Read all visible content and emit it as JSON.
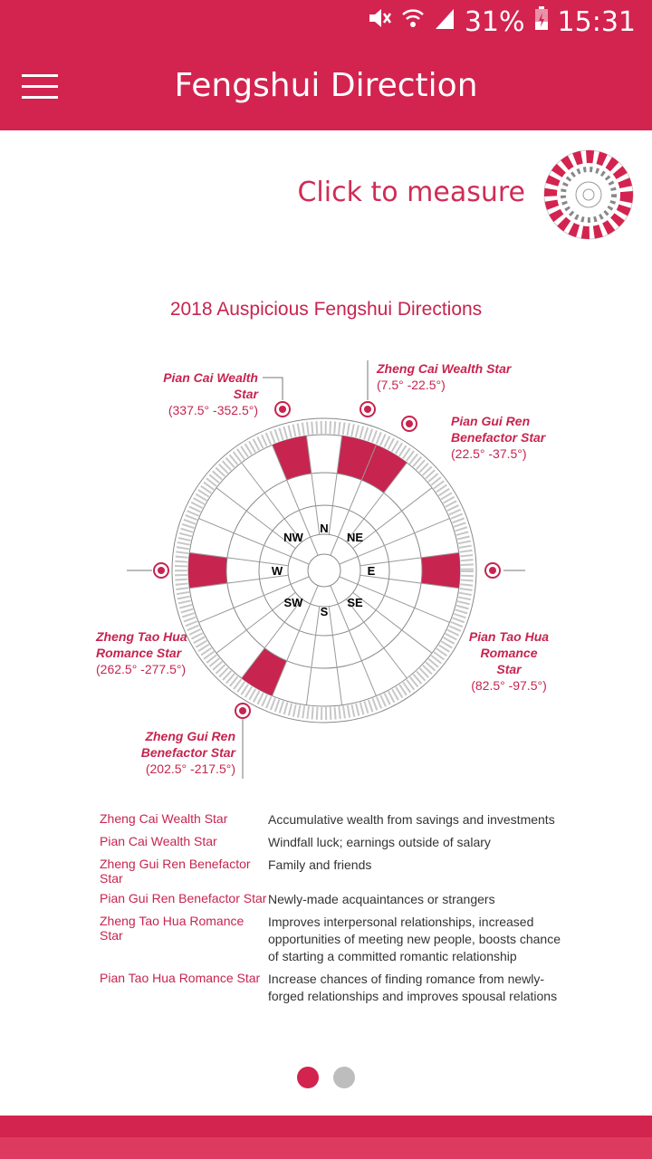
{
  "status": {
    "battery": "31%",
    "time": "15:31"
  },
  "appbar": {
    "title": "Fengshui Direction"
  },
  "measure": {
    "label": "Click to measure"
  },
  "diagram": {
    "title": "2018 Auspicious Fengshui Directions",
    "stars": [
      {
        "name": "Pian Cai Wealth Star",
        "range": "(337.5° -352.5°)"
      },
      {
        "name": "Zheng Cai Wealth Star",
        "range": "(7.5° -22.5°)"
      },
      {
        "name": "Pian Gui Ren Benefactor Star",
        "range": "(22.5° -37.5°)"
      },
      {
        "name": "Pian Tao Hua Romance Star",
        "range": "(82.5° -97.5°)"
      },
      {
        "name": "Zheng Tao Hua Romance Star",
        "range": "(262.5° -277.5°)"
      },
      {
        "name": "Zheng Gui Ren Benefactor Star",
        "range": "(202.5° -217.5°)"
      }
    ],
    "directions": {
      "n": "N",
      "s": "S",
      "e": "E",
      "w": "W",
      "ne": "NE",
      "nw": "NW",
      "se": "SE",
      "sw": "SW"
    }
  },
  "legend": [
    {
      "key": "Zheng Cai Wealth Star",
      "value": "Accumulative wealth from savings and investments"
    },
    {
      "key": "Pian Cai Wealth Star",
      "value": "Windfall luck; earnings outside of salary"
    },
    {
      "key": "Zheng Gui Ren Benefactor Star",
      "value": "Family and friends"
    },
    {
      "key": "Pian Gui Ren Benefactor Star",
      "value": "Newly-made acquaintances or strangers"
    },
    {
      "key": "Zheng Tao Hua Romance Star",
      "value": "Improves interpersonal relationships, increased opportunities of meeting new people, boosts chance of starting a committed romantic relationship"
    },
    {
      "key": "Pian Tao Hua Romance Star",
      "value": "Increase chances of finding romance from newly-forged relationships and improves spousal relations"
    }
  ],
  "pager": {
    "active_color": "#d3234f",
    "inactive_color": "#bdbdbd"
  },
  "colors": {
    "primary": "#d3234f",
    "accent": "#c7244f"
  }
}
